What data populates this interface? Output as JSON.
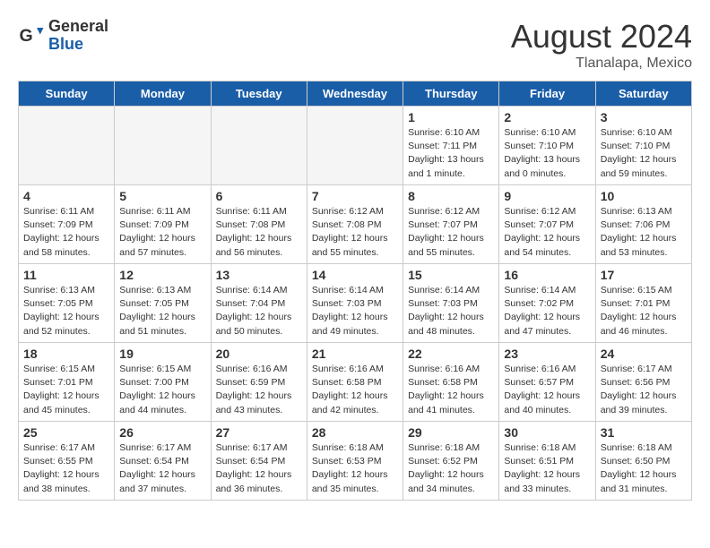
{
  "header": {
    "logo_general": "General",
    "logo_blue": "Blue",
    "month_year": "August 2024",
    "location": "Tlanalapa, Mexico"
  },
  "days_of_week": [
    "Sunday",
    "Monday",
    "Tuesday",
    "Wednesday",
    "Thursday",
    "Friday",
    "Saturday"
  ],
  "weeks": [
    [
      {
        "day": "",
        "info": ""
      },
      {
        "day": "",
        "info": ""
      },
      {
        "day": "",
        "info": ""
      },
      {
        "day": "",
        "info": ""
      },
      {
        "day": "1",
        "info": "Sunrise: 6:10 AM\nSunset: 7:11 PM\nDaylight: 13 hours\nand 1 minute."
      },
      {
        "day": "2",
        "info": "Sunrise: 6:10 AM\nSunset: 7:10 PM\nDaylight: 13 hours\nand 0 minutes."
      },
      {
        "day": "3",
        "info": "Sunrise: 6:10 AM\nSunset: 7:10 PM\nDaylight: 12 hours\nand 59 minutes."
      }
    ],
    [
      {
        "day": "4",
        "info": "Sunrise: 6:11 AM\nSunset: 7:09 PM\nDaylight: 12 hours\nand 58 minutes."
      },
      {
        "day": "5",
        "info": "Sunrise: 6:11 AM\nSunset: 7:09 PM\nDaylight: 12 hours\nand 57 minutes."
      },
      {
        "day": "6",
        "info": "Sunrise: 6:11 AM\nSunset: 7:08 PM\nDaylight: 12 hours\nand 56 minutes."
      },
      {
        "day": "7",
        "info": "Sunrise: 6:12 AM\nSunset: 7:08 PM\nDaylight: 12 hours\nand 55 minutes."
      },
      {
        "day": "8",
        "info": "Sunrise: 6:12 AM\nSunset: 7:07 PM\nDaylight: 12 hours\nand 55 minutes."
      },
      {
        "day": "9",
        "info": "Sunrise: 6:12 AM\nSunset: 7:07 PM\nDaylight: 12 hours\nand 54 minutes."
      },
      {
        "day": "10",
        "info": "Sunrise: 6:13 AM\nSunset: 7:06 PM\nDaylight: 12 hours\nand 53 minutes."
      }
    ],
    [
      {
        "day": "11",
        "info": "Sunrise: 6:13 AM\nSunset: 7:05 PM\nDaylight: 12 hours\nand 52 minutes."
      },
      {
        "day": "12",
        "info": "Sunrise: 6:13 AM\nSunset: 7:05 PM\nDaylight: 12 hours\nand 51 minutes."
      },
      {
        "day": "13",
        "info": "Sunrise: 6:14 AM\nSunset: 7:04 PM\nDaylight: 12 hours\nand 50 minutes."
      },
      {
        "day": "14",
        "info": "Sunrise: 6:14 AM\nSunset: 7:03 PM\nDaylight: 12 hours\nand 49 minutes."
      },
      {
        "day": "15",
        "info": "Sunrise: 6:14 AM\nSunset: 7:03 PM\nDaylight: 12 hours\nand 48 minutes."
      },
      {
        "day": "16",
        "info": "Sunrise: 6:14 AM\nSunset: 7:02 PM\nDaylight: 12 hours\nand 47 minutes."
      },
      {
        "day": "17",
        "info": "Sunrise: 6:15 AM\nSunset: 7:01 PM\nDaylight: 12 hours\nand 46 minutes."
      }
    ],
    [
      {
        "day": "18",
        "info": "Sunrise: 6:15 AM\nSunset: 7:01 PM\nDaylight: 12 hours\nand 45 minutes."
      },
      {
        "day": "19",
        "info": "Sunrise: 6:15 AM\nSunset: 7:00 PM\nDaylight: 12 hours\nand 44 minutes."
      },
      {
        "day": "20",
        "info": "Sunrise: 6:16 AM\nSunset: 6:59 PM\nDaylight: 12 hours\nand 43 minutes."
      },
      {
        "day": "21",
        "info": "Sunrise: 6:16 AM\nSunset: 6:58 PM\nDaylight: 12 hours\nand 42 minutes."
      },
      {
        "day": "22",
        "info": "Sunrise: 6:16 AM\nSunset: 6:58 PM\nDaylight: 12 hours\nand 41 minutes."
      },
      {
        "day": "23",
        "info": "Sunrise: 6:16 AM\nSunset: 6:57 PM\nDaylight: 12 hours\nand 40 minutes."
      },
      {
        "day": "24",
        "info": "Sunrise: 6:17 AM\nSunset: 6:56 PM\nDaylight: 12 hours\nand 39 minutes."
      }
    ],
    [
      {
        "day": "25",
        "info": "Sunrise: 6:17 AM\nSunset: 6:55 PM\nDaylight: 12 hours\nand 38 minutes."
      },
      {
        "day": "26",
        "info": "Sunrise: 6:17 AM\nSunset: 6:54 PM\nDaylight: 12 hours\nand 37 minutes."
      },
      {
        "day": "27",
        "info": "Sunrise: 6:17 AM\nSunset: 6:54 PM\nDaylight: 12 hours\nand 36 minutes."
      },
      {
        "day": "28",
        "info": "Sunrise: 6:18 AM\nSunset: 6:53 PM\nDaylight: 12 hours\nand 35 minutes."
      },
      {
        "day": "29",
        "info": "Sunrise: 6:18 AM\nSunset: 6:52 PM\nDaylight: 12 hours\nand 34 minutes."
      },
      {
        "day": "30",
        "info": "Sunrise: 6:18 AM\nSunset: 6:51 PM\nDaylight: 12 hours\nand 33 minutes."
      },
      {
        "day": "31",
        "info": "Sunrise: 6:18 AM\nSunset: 6:50 PM\nDaylight: 12 hours\nand 31 minutes."
      }
    ]
  ]
}
